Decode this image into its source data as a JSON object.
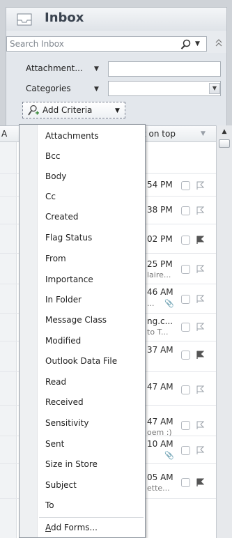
{
  "header": {
    "title": "Inbox",
    "icon": "inbox-icon"
  },
  "search": {
    "placeholder": "Search Inbox",
    "icon": "search-icon"
  },
  "criteria": {
    "attachment_label": "Attachment...",
    "categories_label": "Categories",
    "add_criteria_label": "Add Criteria"
  },
  "list_header": {
    "left": "A",
    "sort": "t on top"
  },
  "messages": [
    {
      "time": "54 PM",
      "preview": "",
      "clip": "",
      "flag": "empty"
    },
    {
      "time": "38 PM",
      "preview": "",
      "clip": "",
      "flag": "empty"
    },
    {
      "time": "02 PM",
      "preview": "",
      "clip": "",
      "flag": "dark"
    },
    {
      "time": "25 PM",
      "preview": "laire...",
      "clip": "",
      "flag": "empty"
    },
    {
      "time": "46 AM",
      "preview": "...",
      "clip": "📎",
      "flag": "empty"
    },
    {
      "time": "ng.c...",
      "preview": "to T...",
      "clip": "",
      "flag": "empty"
    },
    {
      "time": "37 AM",
      "preview": "",
      "clip": "",
      "flag": "dark"
    },
    {
      "time": "47 AM",
      "preview": "",
      "clip": "",
      "flag": "empty"
    },
    {
      "time": "47 AM",
      "preview": "oem :)",
      "clip": "",
      "flag": "empty"
    },
    {
      "time": "10 AM",
      "preview": "",
      "clip": "📎",
      "flag": "empty"
    },
    {
      "time": "05 AM",
      "preview": "ette...",
      "clip": "",
      "flag": "dark"
    }
  ],
  "menu": {
    "items": [
      "Attachments",
      "Bcc",
      "Body",
      "Cc",
      "Created",
      "Flag Status",
      "From",
      "Importance",
      "In Folder",
      "Message Class",
      "Modified",
      "Outlook Data File",
      "Read",
      "Received",
      "Sensitivity",
      "Sent",
      "Size in Store",
      "Subject",
      "To"
    ],
    "add_forms_prefix": "A",
    "add_forms_rest": "dd Forms..."
  },
  "colors": {
    "frame": "#cfd3d8",
    "header_text": "#3b4450",
    "dark_flag": "#555555"
  }
}
